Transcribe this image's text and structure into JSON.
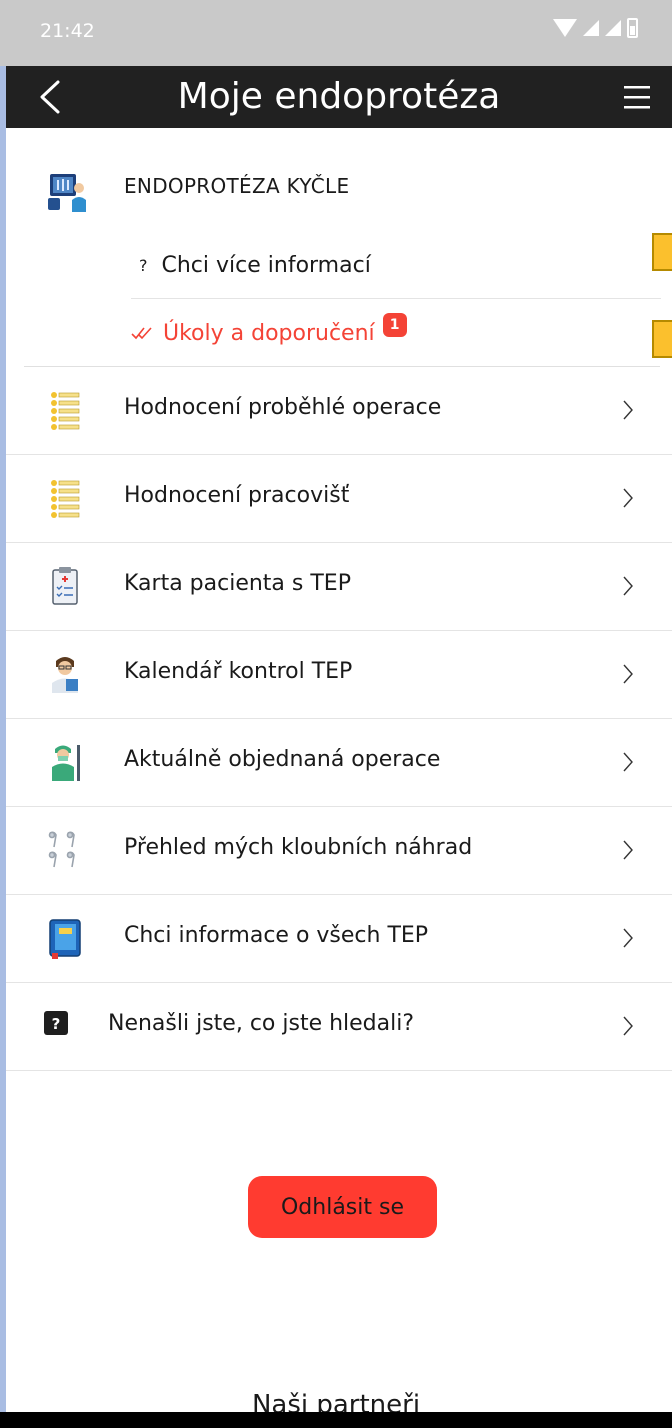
{
  "status_bar": {
    "time": "21:42"
  },
  "app_bar": {
    "title": "Moje endoprotéza"
  },
  "section": {
    "title": "ENDOPROTÉZA KYČLE",
    "info_mark": "?",
    "info_label": "Chci více informací",
    "tasks_label": "Úkoly a doporučení",
    "tasks_badge": "1",
    "accent_color": "#f44336"
  },
  "menu_items": [
    {
      "label": "Hodnocení proběhlé operace",
      "icon": "rating-list-icon"
    },
    {
      "label": "Hodnocení pracovišť",
      "icon": "rating-list-icon"
    },
    {
      "label": "Karta pacienta s TEP",
      "icon": "clipboard-icon"
    },
    {
      "label": "Kalendář kontrol TEP",
      "icon": "doctor-icon"
    },
    {
      "label": "Aktuálně objednaná operace",
      "icon": "surgeon-icon"
    },
    {
      "label": "Přehled mých kloubních náhrad",
      "icon": "joints-icon"
    },
    {
      "label": "Chci informace o všech TEP",
      "icon": "book-icon"
    },
    {
      "label": "Nenašli jste, co jste hledali?",
      "icon": "question-icon",
      "help_mark": "?"
    }
  ],
  "logout": {
    "label": "Odhlásit se",
    "color": "#ff3b30"
  },
  "partners": {
    "title": "Naši partneři"
  }
}
